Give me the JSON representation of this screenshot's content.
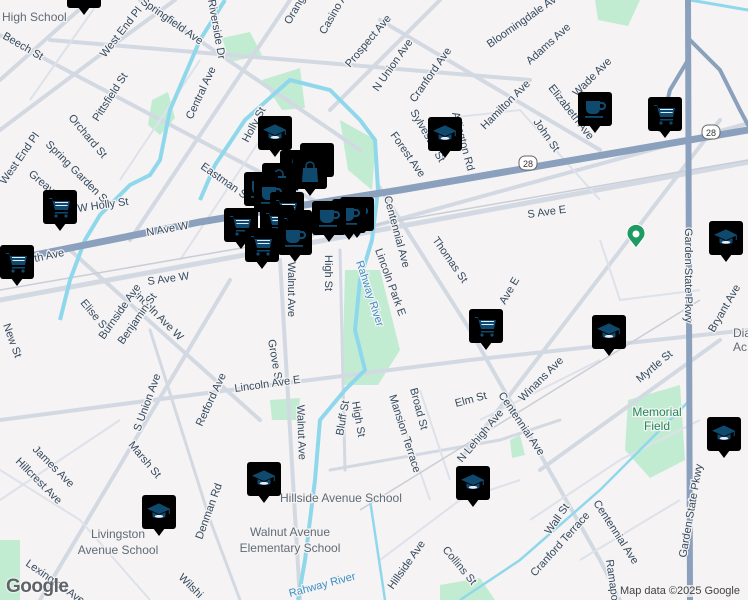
{
  "map": {
    "labels": [
      "High School",
      "Beech St",
      "West End Pl",
      "Springfield Ave",
      "Orange Ave",
      "Casino Ave",
      "Prospect Ave",
      "N Union Ave",
      "Bloomingdale Ave",
      "Adams Ave",
      "Cranford Ave",
      "Sylvester St",
      "Hamilton Ave",
      "Arlington Rd",
      "Elizabeth Ave",
      "Wade Ave",
      "John St",
      "Forest Ave",
      "Pittsfield St",
      "Central Ave",
      "Orchard St",
      "Holly St",
      "Spring Garden St",
      "West End Pl",
      "Greav",
      "Eastman St",
      "W Holly St",
      "N Ave W",
      "th Ave",
      "S Ave W",
      "S Ave E",
      "Centennial Ave",
      "Thomas St",
      "Lincoln Park E",
      "High St",
      "Walnut Ave",
      "Lincoln Ave W",
      "Elise St",
      "Burnside Ave",
      "Benjamin St",
      "New St",
      "Grove St",
      "Walnut Ave",
      "Retford Ave",
      "S Union Ave",
      "Lincoln Ave E",
      "Bluff St",
      "High St",
      "Mansion Terrace",
      "Broad St",
      "Elm St",
      "N Lehigh Ave",
      "Winans Ave",
      "Centennial Ave",
      "Myrtle St",
      "Garden State Pkwy",
      "Garden State Pkwy",
      "Bryant Ave",
      "Marsh St",
      "James Ave",
      "Hillcrest Ave",
      "Denman Rd",
      "Wall St",
      "Cranford Terrace",
      "Centennial Ave",
      "Hillside Ave",
      "Collins St",
      "Lexington Ave",
      "Wilshi",
      "Ramapo",
      "Ave E",
      "Riverside Dr"
    ],
    "pois": {
      "walnut_school": [
        "Walnut Avenue",
        "Elementary School"
      ],
      "livingston_school": [
        "Livingston",
        "Avenue School"
      ],
      "hillside_school": "Hillside Avenue School",
      "memorial_field": [
        "Memorial",
        "Field"
      ],
      "dia": [
        "Dia",
        "Ac"
      ]
    },
    "rivers": [
      "Rahway River",
      "Rahway River"
    ],
    "route_shields": [
      "28",
      "28"
    ],
    "markers": [
      "school",
      "school",
      "school",
      "school",
      "school",
      "school",
      "school",
      "school",
      "cart",
      "cart",
      "cart",
      "cart",
      "cart",
      "cart",
      "coffee",
      "coffee",
      "coffee",
      "shopping-bag"
    ],
    "colors": {
      "marker_fill": "#e3ecfc",
      "marker_icon": "#0f4a6e",
      "highway": "#8aa0bc",
      "park": "#c2ecd2",
      "water": "#8fd8ec",
      "pin": "#1e9b62"
    },
    "credit": "Map data ©2025 Google",
    "logo": "Google"
  }
}
